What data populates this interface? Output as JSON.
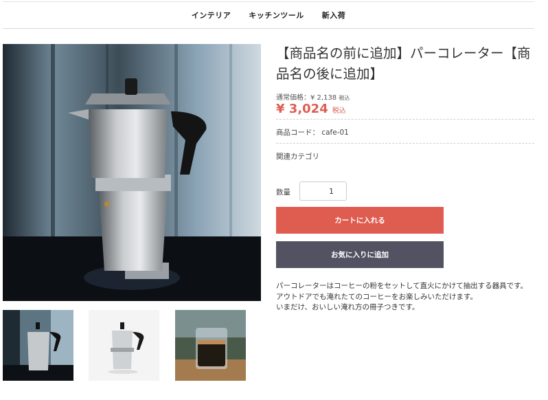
{
  "nav": {
    "items": [
      "インテリア",
      "キッチンツール",
      "新入荷"
    ]
  },
  "product": {
    "title": "【商品名の前に追加】パーコレーター【商品名の後に追加】",
    "regular_price_label": "通常価格：¥ 2,138",
    "regular_price_tax": "税込",
    "price": "¥ 3,024",
    "price_tax": "税込",
    "code": "商品コード： cafe-01",
    "category_label": "関連カテゴリ",
    "quantity_label": "数量",
    "quantity_value": "1",
    "add_to_cart": "カートに入れる",
    "add_to_favorite": "お気に入りに追加",
    "description": [
      "パーコレーターはコーヒーの粉をセットして直火にかけて抽出する器具です。",
      "アウトドアでも淹れたてのコーヒーをお楽しみいただけます。",
      "いまだけ、おいしい淹れ方の冊子つきです。"
    ]
  },
  "colors": {
    "accent": "#de5d50",
    "dark_button": "#525263"
  }
}
